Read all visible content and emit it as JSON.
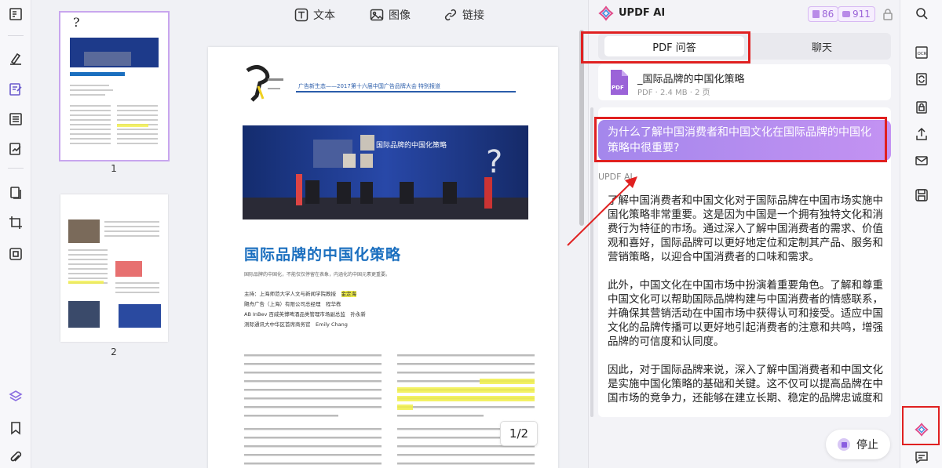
{
  "doc_toolbar": {
    "text_label": "文本",
    "image_label": "图像",
    "link_label": "链接"
  },
  "thumbnails": [
    {
      "number": "1"
    },
    {
      "number": "2"
    }
  ],
  "page_content": {
    "header_title": "广告新生态——2017第十六届中国广告品牌大会 特别报道",
    "article_title": "国际品牌的中国化策略",
    "subtitle": "国际品牌的中国化，不能仅仅停留在表象，内涵化的中国元素更重要。",
    "participants": [
      {
        "role": "主持：上海师范大学人文与新闻学院教授",
        "name": "金定海"
      },
      {
        "role": "飓舟广告（上海）有限公司总经理",
        "name": "程华栋"
      },
      {
        "role": "AB InBev 百威英博啤酒品类管理市场副总监",
        "name": "孙永新"
      },
      {
        "role": "测际通讯大中华区首席商务官",
        "name": "Emily Chang"
      }
    ]
  },
  "page_indicator": "1/2",
  "ai_panel": {
    "title": "UPDF AI",
    "badge_1": "86",
    "badge_2": "911",
    "tab_pdf": "PDF 问答",
    "tab_chat": "聊天",
    "file": {
      "name": "_国际品牌的中国化策略",
      "meta": "PDF · 2.4 MB · 2 页",
      "icon_text": "PDF"
    },
    "question": "为什么了解中国消费者和中国文化在国际品牌的中国化策略中很重要?",
    "answer_label": "UPDF AI",
    "answer_paragraphs": [
      "了解中国消费者和中国文化对于国际品牌在中国市场实施中国化策略非常重要。这是因为中国是一个拥有独特文化和消费行为特征的市场。通过深入了解中国消费者的需求、价值观和喜好，国际品牌可以更好地定位和定制其产品、服务和营销策略，以迎合中国消费者的口味和需求。",
      "此外，中国文化在中国市场中扮演着重要角色。了解和尊重中国文化可以帮助国际品牌构建与中国消费者的情感联系，并确保其营销活动在中国市场中获得认可和接受。适应中国文化的品牌传播可以更好地引起消费者的注意和共鸣，增强品牌的可信度和认同度。",
      "因此，对于国际品牌来说，深入了解中国消费者和中国文化是实施中国化策略的基础和关键。这不仅可以提高品牌在中国市场的竞争力，还能够在建立长期、稳定的品牌忠诚度和"
    ],
    "stop_label": "停止"
  },
  "colors": {
    "accent": "#9b63d8",
    "highlight_red": "#e02020",
    "question_gradient_start": "#a487ec",
    "question_gradient_end": "#c392f2"
  }
}
